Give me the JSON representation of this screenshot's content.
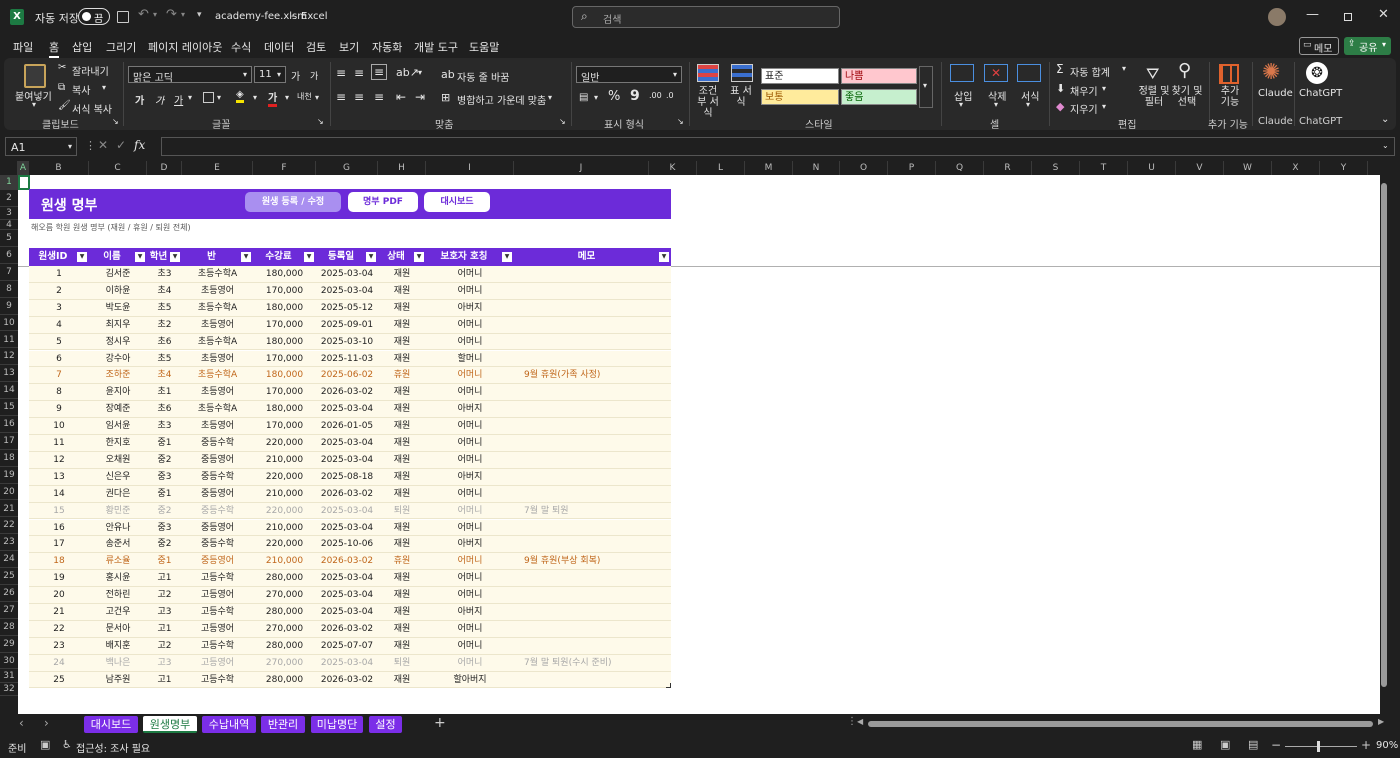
{
  "window": {
    "autosave_label": "자동 저장",
    "autosave_state": "끔",
    "filename": "academy-fee.xlsm",
    "app": "Excel",
    "search_placeholder": "검색"
  },
  "menu": [
    "파일",
    "홈",
    "삽입",
    "그리기",
    "페이지 레이아웃",
    "수식",
    "데이터",
    "검토",
    "보기",
    "자동화",
    "개발 도구",
    "도움말"
  ],
  "menu_right": {
    "comment": "메모",
    "share": "공유"
  },
  "ribbon": {
    "clipboard": {
      "paste": "붙여넣기",
      "cut": "잘라내기",
      "copy": "복사",
      "format_painter": "서식 복사",
      "label": "클립보드"
    },
    "font": {
      "name": "맑은 고딕",
      "size": "11",
      "label": "글꼴",
      "grow": "가",
      "shrink": "가",
      "bold": "가",
      "italic": "가",
      "underline": "가",
      "phonetic": "내천"
    },
    "alignment": {
      "wrap": "자동 줄 바꿈",
      "merge": "병합하고 가운데 맞춤",
      "label": "맞춤"
    },
    "number": {
      "format": "일반",
      "label": "표시 형식"
    },
    "styles": {
      "conditional": "조건부 서식",
      "table": "표 서식",
      "normal": "표준",
      "bad": "나쁨",
      "neutral": "보통",
      "good": "좋음",
      "label": "스타일"
    },
    "cells": {
      "insert": "삽입",
      "delete": "삭제",
      "format": "서식",
      "label": "셀"
    },
    "editing": {
      "autosum": "자동 합계",
      "fill": "채우기",
      "clear": "지우기",
      "sort": "정렬 및 필터",
      "find": "찾기 및 선택",
      "label": "편집"
    },
    "addins": {
      "label": "추가 기능",
      "button": "추가 기능"
    },
    "claude": {
      "label": "Claude",
      "button": "Claude"
    },
    "chatgpt": {
      "label": "ChatGPT",
      "button": "ChatGPT"
    },
    "colors": {
      "normal": "#ffffff",
      "bad": "#ffc7ce",
      "neutral": "#ffeb9c",
      "good": "#c6efce"
    }
  },
  "formula": {
    "namebox": "A1",
    "fx": "fx",
    "value": ""
  },
  "columns": [
    "A",
    "B",
    "C",
    "D",
    "E",
    "F",
    "G",
    "H",
    "I",
    "J",
    "K",
    "L",
    "M",
    "N",
    "O",
    "P",
    "Q",
    "R",
    "S",
    "T",
    "U",
    "V",
    "W",
    "X",
    "Y"
  ],
  "rows": [
    "1",
    "2",
    "3",
    "4",
    "5",
    "6",
    "7",
    "8",
    "9",
    "10",
    "11",
    "12",
    "13",
    "14",
    "15",
    "16",
    "17",
    "18",
    "19",
    "20",
    "21",
    "22",
    "23",
    "24",
    "25",
    "26",
    "27",
    "28",
    "29",
    "30",
    "31",
    "32"
  ],
  "sheet": {
    "title": "원생 명부",
    "subtitle": "해오름 학원 원생 명부 (재원 / 휴원 / 퇴원 전체)",
    "buttons": [
      "원생 등록 / 수정",
      "명부 PDF",
      "대시보드"
    ],
    "header_color": "#6c2bd9",
    "headers": [
      "원생ID",
      "이름",
      "학년",
      "반",
      "수강료",
      "등록일",
      "상태",
      "보호자 호칭",
      "메모"
    ],
    "records": [
      [
        "1",
        "김서준",
        "초3",
        "초등수학A",
        "180,000",
        "2025-03-04",
        "재원",
        "어머니",
        ""
      ],
      [
        "2",
        "이하윤",
        "초4",
        "초등영어",
        "170,000",
        "2025-03-04",
        "재원",
        "어머니",
        ""
      ],
      [
        "3",
        "박도윤",
        "초5",
        "초등수학A",
        "180,000",
        "2025-05-12",
        "재원",
        "아버지",
        ""
      ],
      [
        "4",
        "최지우",
        "초2",
        "초등영어",
        "170,000",
        "2025-09-01",
        "재원",
        "어머니",
        ""
      ],
      [
        "5",
        "정시우",
        "초6",
        "초등수학A",
        "180,000",
        "2025-03-10",
        "재원",
        "어머니",
        ""
      ],
      [
        "6",
        "강수아",
        "초5",
        "초등영어",
        "170,000",
        "2025-11-03",
        "재원",
        "할머니",
        ""
      ],
      [
        "7",
        "조하준",
        "초4",
        "초등수학A",
        "180,000",
        "2025-06-02",
        "휴원",
        "어머니",
        "9월 휴원(가족 사정)"
      ],
      [
        "8",
        "윤지아",
        "초1",
        "초등영어",
        "170,000",
        "2026-03-02",
        "재원",
        "어머니",
        ""
      ],
      [
        "9",
        "장예준",
        "초6",
        "초등수학A",
        "180,000",
        "2025-03-04",
        "재원",
        "아버지",
        ""
      ],
      [
        "10",
        "임서윤",
        "초3",
        "초등영어",
        "170,000",
        "2026-01-05",
        "재원",
        "어머니",
        ""
      ],
      [
        "11",
        "한지호",
        "중1",
        "중등수학",
        "220,000",
        "2025-03-04",
        "재원",
        "어머니",
        ""
      ],
      [
        "12",
        "오채원",
        "중2",
        "중등영어",
        "210,000",
        "2025-03-04",
        "재원",
        "어머니",
        ""
      ],
      [
        "13",
        "신은우",
        "중3",
        "중등수학",
        "220,000",
        "2025-08-18",
        "재원",
        "아버지",
        ""
      ],
      [
        "14",
        "권다은",
        "중1",
        "중등영어",
        "210,000",
        "2026-03-02",
        "재원",
        "어머니",
        ""
      ],
      [
        "15",
        "황민준",
        "중2",
        "중등수학",
        "220,000",
        "2025-03-04",
        "퇴원",
        "어머니",
        "7월 말 퇴원"
      ],
      [
        "16",
        "안유나",
        "중3",
        "중등영어",
        "210,000",
        "2025-03-04",
        "재원",
        "어머니",
        ""
      ],
      [
        "17",
        "송준서",
        "중2",
        "중등수학",
        "220,000",
        "2025-10-06",
        "재원",
        "아버지",
        ""
      ],
      [
        "18",
        "류소율",
        "중1",
        "중등영어",
        "210,000",
        "2026-03-02",
        "휴원",
        "어머니",
        "9월 휴원(부상 회복)"
      ],
      [
        "19",
        "홍시윤",
        "고1",
        "고등수학",
        "280,000",
        "2025-03-04",
        "재원",
        "어머니",
        ""
      ],
      [
        "20",
        "전하린",
        "고2",
        "고등영어",
        "270,000",
        "2025-03-04",
        "재원",
        "어머니",
        ""
      ],
      [
        "21",
        "고건우",
        "고3",
        "고등수학",
        "280,000",
        "2025-03-04",
        "재원",
        "아버지",
        ""
      ],
      [
        "22",
        "문서아",
        "고1",
        "고등영어",
        "270,000",
        "2026-03-02",
        "재원",
        "어머니",
        ""
      ],
      [
        "23",
        "배지훈",
        "고2",
        "고등수학",
        "280,000",
        "2025-07-07",
        "재원",
        "어머니",
        ""
      ],
      [
        "24",
        "백나은",
        "고3",
        "고등영어",
        "270,000",
        "2025-03-04",
        "퇴원",
        "어머니",
        "7월 말 퇴원(수시 준비)"
      ],
      [
        "25",
        "남주원",
        "고1",
        "고등수학",
        "280,000",
        "2026-03-02",
        "재원",
        "할아버지",
        ""
      ]
    ],
    "status_colors": {
      "재원": "#222222",
      "휴원": "#c0661a",
      "퇴원": "#a8a8a8"
    }
  },
  "tabs": [
    "대시보드",
    "원생명부",
    "수납내역",
    "반관리",
    "미납명단",
    "설정"
  ],
  "active_tab": "원생명부",
  "status": {
    "ready": "준비",
    "accessibility": "접근성: 조사 필요",
    "zoom": "90%"
  }
}
